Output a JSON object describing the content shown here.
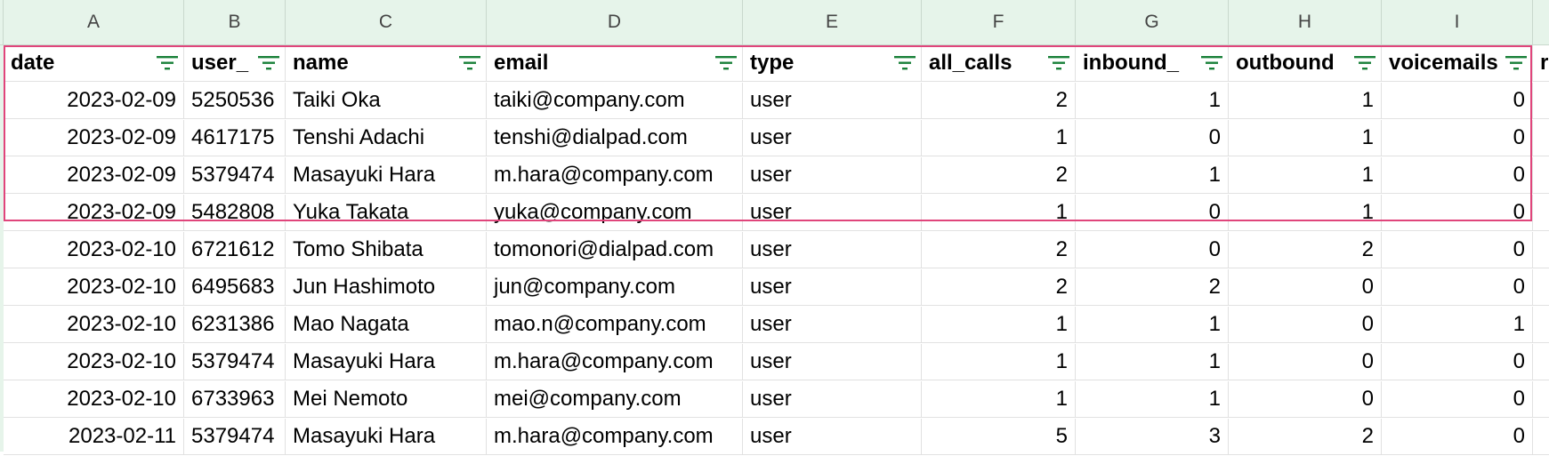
{
  "sheet": {
    "column_letters": [
      "A",
      "B",
      "C",
      "D",
      "E",
      "F",
      "G",
      "H",
      "I"
    ],
    "headers": [
      "date",
      "user_",
      "name",
      "email",
      "type",
      "all_calls",
      "inbound_",
      "outbound",
      "voicemails",
      "r"
    ],
    "rows": [
      [
        "2023-02-09",
        "5250536",
        "Taiki Oka",
        "taiki@company.com",
        "user",
        "2",
        "1",
        "1",
        "0"
      ],
      [
        "2023-02-09",
        "4617175",
        "Tenshi Adachi",
        "tenshi@dialpad.com",
        "user",
        "1",
        "0",
        "1",
        "0"
      ],
      [
        "2023-02-09",
        "5379474",
        "Masayuki Hara",
        "m.hara@company.com",
        "user",
        "2",
        "1",
        "1",
        "0"
      ],
      [
        "2023-02-09",
        "5482808",
        "Yuka Takata",
        "yuka@company.com",
        "user",
        "1",
        "0",
        "1",
        "0"
      ],
      [
        "2023-02-10",
        "6721612",
        "Tomo Shibata",
        "tomonori@dialpad.com",
        "user",
        "2",
        "0",
        "2",
        "0"
      ],
      [
        "2023-02-10",
        "6495683",
        "Jun Hashimoto",
        "jun@company.com",
        "user",
        "2",
        "2",
        "0",
        "0"
      ],
      [
        "2023-02-10",
        "6231386",
        "Mao Nagata",
        "mao.n@company.com",
        "user",
        "1",
        "1",
        "0",
        "1"
      ],
      [
        "2023-02-10",
        "5379474",
        "Masayuki Hara",
        "m.hara@company.com",
        "user",
        "1",
        "1",
        "0",
        "0"
      ],
      [
        "2023-02-10",
        "6733963",
        "Mei Nemoto",
        "mei@company.com",
        "user",
        "1",
        "1",
        "0",
        "0"
      ],
      [
        "2023-02-11",
        "5379474",
        "Masayuki Hara",
        "m.hara@company.com",
        "user",
        "5",
        "3",
        "2",
        "0"
      ]
    ],
    "numeric_columns": [
      0,
      5,
      6,
      7,
      8
    ],
    "filter_icon": "filter-icon",
    "colors": {
      "header_bg": "#e6f4ea",
      "selection": "#e0457b",
      "filter": "#188038"
    }
  }
}
